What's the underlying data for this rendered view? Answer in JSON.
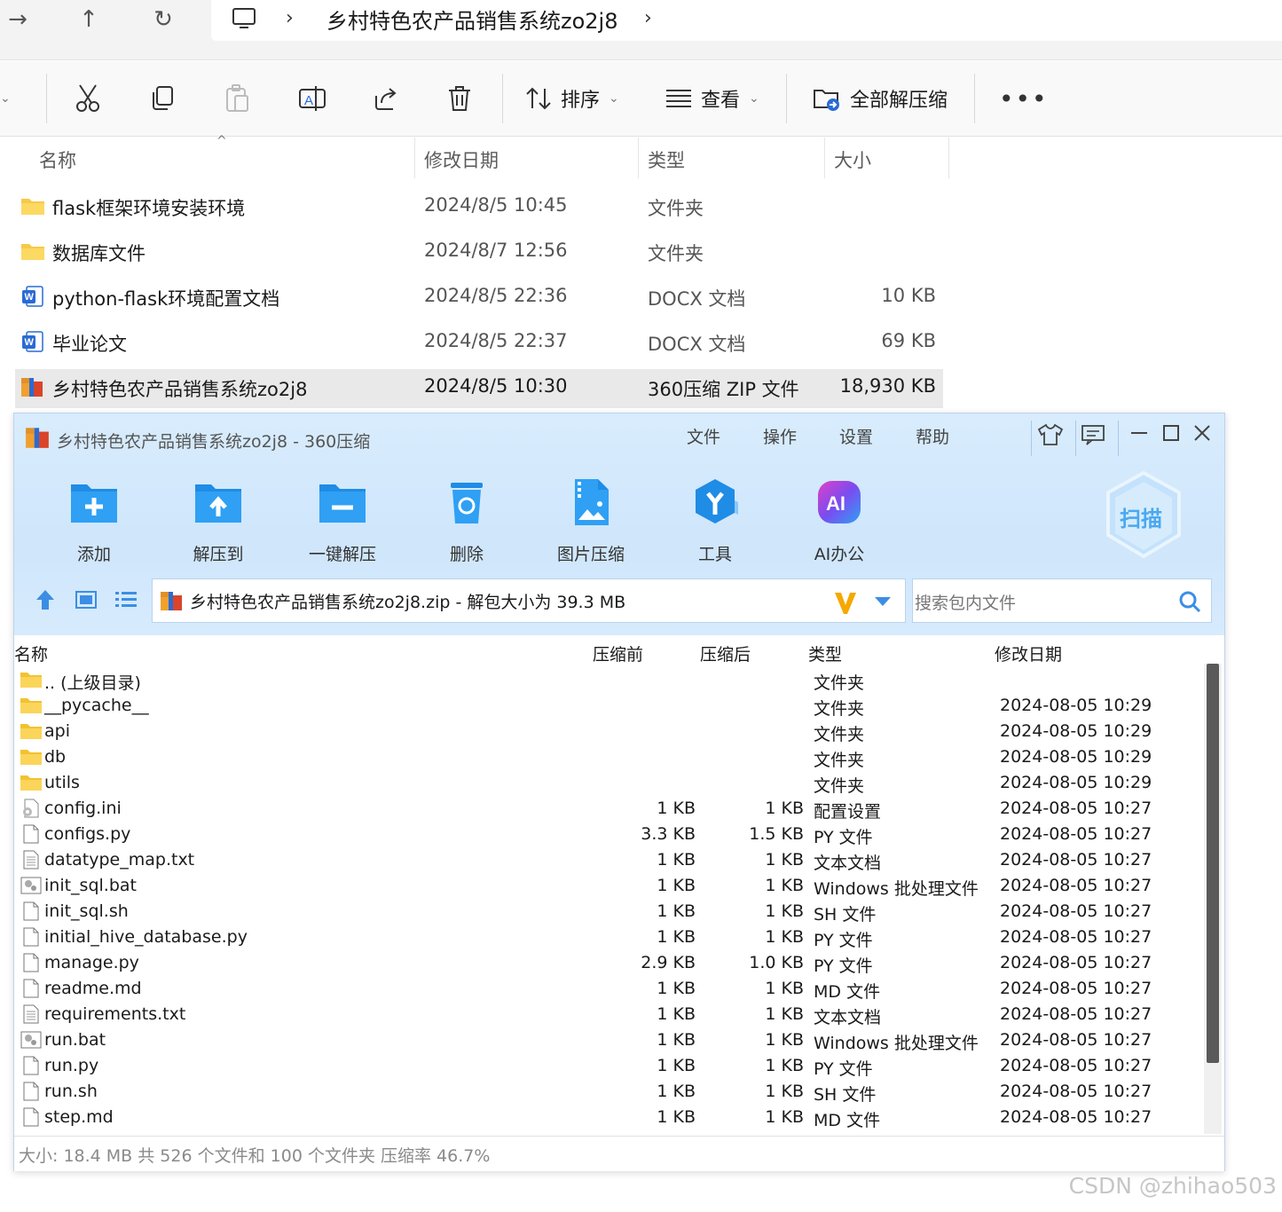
{
  "explorer": {
    "breadcrumb_title": "乡村特色农产品销售系统zo2j8",
    "toolbar": {
      "sort_label": "排序",
      "view_label": "查看",
      "extract_all_label": "全部解压缩"
    },
    "columns": {
      "name": "名称",
      "date": "修改日期",
      "type": "类型",
      "size": "大小"
    },
    "rows": [
      {
        "icon": "folder-icon",
        "name": "flask框架环境安装环境",
        "date": "2024/8/5 10:45",
        "type": "文件夹",
        "size": ""
      },
      {
        "icon": "folder-icon",
        "name": "数据库文件",
        "date": "2024/8/7 12:56",
        "type": "文件夹",
        "size": ""
      },
      {
        "icon": "word-doc-icon",
        "name": "python-flask环境配置文档",
        "date": "2024/8/5 22:36",
        "type": "DOCX 文档",
        "size": "10 KB"
      },
      {
        "icon": "word-doc-icon",
        "name": "毕业论文",
        "date": "2024/8/5 22:37",
        "type": "DOCX 文档",
        "size": "69 KB"
      },
      {
        "icon": "zip-archive-icon",
        "name": "乡村特色农产品销售系统zo2j8",
        "date": "2024/8/5 10:30",
        "type": "360压缩 ZIP 文件",
        "size": "18,930 KB"
      }
    ]
  },
  "zip": {
    "window_title": "乡村特色农产品销售系统zo2j8 - 360压缩",
    "menu": [
      "文件",
      "操作",
      "设置",
      "帮助"
    ],
    "tools": [
      "添加",
      "解压到",
      "一键解压",
      "删除",
      "图片压缩",
      "工具",
      "AI办公"
    ],
    "scan_label": "扫描",
    "path_text": "乡村特色农产品销售系统zo2j8.zip - 解包大小为 39.3 MB",
    "search_placeholder": "搜索包内文件",
    "columns": {
      "name": "名称",
      "before": "压缩前",
      "after": "压缩后",
      "type": "类型",
      "date": "修改日期"
    },
    "rows": [
      {
        "icon": "folder-icon",
        "name": ".. (上级目录)",
        "before": "",
        "after": "",
        "type": "文件夹",
        "date": ""
      },
      {
        "icon": "folder-icon",
        "name": "__pycache__",
        "before": "",
        "after": "",
        "type": "文件夹",
        "date": "2024-08-05 10:29"
      },
      {
        "icon": "folder-icon",
        "name": "api",
        "before": "",
        "after": "",
        "type": "文件夹",
        "date": "2024-08-05 10:29"
      },
      {
        "icon": "folder-icon",
        "name": "db",
        "before": "",
        "after": "",
        "type": "文件夹",
        "date": "2024-08-05 10:29"
      },
      {
        "icon": "folder-icon",
        "name": "utils",
        "before": "",
        "after": "",
        "type": "文件夹",
        "date": "2024-08-05 10:29"
      },
      {
        "icon": "settings-file-icon",
        "name": "config.ini",
        "before": "1 KB",
        "after": "1 KB",
        "type": "配置设置",
        "date": "2024-08-05 10:27"
      },
      {
        "icon": "file-icon",
        "name": "configs.py",
        "before": "3.3 KB",
        "after": "1.5 KB",
        "type": "PY 文件",
        "date": "2024-08-05 10:27"
      },
      {
        "icon": "text-file-icon",
        "name": "datatype_map.txt",
        "before": "1 KB",
        "after": "1 KB",
        "type": "文本文档",
        "date": "2024-08-05 10:27"
      },
      {
        "icon": "batch-file-icon",
        "name": "init_sql.bat",
        "before": "1 KB",
        "after": "1 KB",
        "type": "Windows 批处理文件",
        "date": "2024-08-05 10:27"
      },
      {
        "icon": "file-icon",
        "name": "init_sql.sh",
        "before": "1 KB",
        "after": "1 KB",
        "type": "SH 文件",
        "date": "2024-08-05 10:27"
      },
      {
        "icon": "file-icon",
        "name": "initial_hive_database.py",
        "before": "1 KB",
        "after": "1 KB",
        "type": "PY 文件",
        "date": "2024-08-05 10:27"
      },
      {
        "icon": "file-icon",
        "name": "manage.py",
        "before": "2.9 KB",
        "after": "1.0 KB",
        "type": "PY 文件",
        "date": "2024-08-05 10:27"
      },
      {
        "icon": "file-icon",
        "name": "readme.md",
        "before": "1 KB",
        "after": "1 KB",
        "type": "MD 文件",
        "date": "2024-08-05 10:27"
      },
      {
        "icon": "text-file-icon",
        "name": "requirements.txt",
        "before": "1 KB",
        "after": "1 KB",
        "type": "文本文档",
        "date": "2024-08-05 10:27"
      },
      {
        "icon": "batch-file-icon",
        "name": "run.bat",
        "before": "1 KB",
        "after": "1 KB",
        "type": "Windows 批处理文件",
        "date": "2024-08-05 10:27"
      },
      {
        "icon": "file-icon",
        "name": "run.py",
        "before": "1 KB",
        "after": "1 KB",
        "type": "PY 文件",
        "date": "2024-08-05 10:27"
      },
      {
        "icon": "file-icon",
        "name": "run.sh",
        "before": "1 KB",
        "after": "1 KB",
        "type": "SH 文件",
        "date": "2024-08-05 10:27"
      },
      {
        "icon": "file-icon",
        "name": "step.md",
        "before": "1 KB",
        "after": "1 KB",
        "type": "MD 文件",
        "date": "2024-08-05 10:27"
      }
    ],
    "status_text": "大小: 18.4 MB 共 526 个文件和 100 个文件夹 压缩率 46.7%"
  },
  "watermark": "CSDN @zhihao503",
  "colors": {
    "accent_blue": "#2a8ae6",
    "folder_yellow": "#f7c948",
    "zip_bg": "#d3e9fc"
  }
}
